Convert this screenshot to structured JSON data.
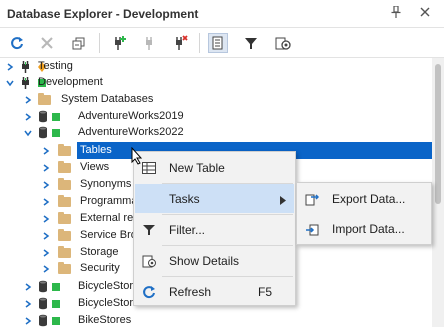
{
  "window": {
    "title": "Database Explorer - Development"
  },
  "titlebar_icons": [
    "pin-icon",
    "close-icon"
  ],
  "toolbar": {
    "buttons": [
      {
        "name": "refresh-button",
        "icon": "refresh-icon"
      },
      {
        "name": "delete-button",
        "icon": "delete-icon"
      },
      {
        "name": "collapse-all-button",
        "icon": "collapse-icon"
      },
      {
        "name": "new-connection-button",
        "icon": "plug-add-icon"
      },
      {
        "name": "disconnect-button",
        "icon": "plug-icon"
      },
      {
        "name": "delete-connection-button",
        "icon": "plug-delete-icon"
      },
      {
        "name": "show-details-button",
        "icon": "details-icon"
      },
      {
        "name": "filter-button",
        "icon": "filter-icon"
      },
      {
        "name": "connection-settings-button",
        "icon": "connection-settings-icon"
      }
    ]
  },
  "tree": [
    {
      "label": "Testing",
      "level": 0,
      "icon": "connection",
      "expander": "right"
    },
    {
      "label": "Development",
      "level": 0,
      "icon": "connection",
      "expander": "down"
    },
    {
      "label": "System Databases",
      "level": 1,
      "icon": "folder",
      "expander": "right"
    },
    {
      "label": "AdventureWorks2019",
      "level": 1,
      "icon": "database",
      "expander": "right"
    },
    {
      "label": "AdventureWorks2022",
      "level": 1,
      "icon": "database",
      "expander": "down"
    },
    {
      "label": "Tables",
      "level": 2,
      "icon": "folder",
      "expander": "right",
      "selected": true
    },
    {
      "label": "Views",
      "level": 2,
      "icon": "folder",
      "expander": "right"
    },
    {
      "label": "Synonyms",
      "level": 2,
      "icon": "folder",
      "expander": "right"
    },
    {
      "label": "Programma",
      "level": 2,
      "icon": "folder",
      "expander": "right"
    },
    {
      "label": "External re",
      "level": 2,
      "icon": "folder",
      "expander": "right"
    },
    {
      "label": "Service Bro",
      "level": 2,
      "icon": "folder",
      "expander": "right"
    },
    {
      "label": "Storage",
      "level": 2,
      "icon": "folder",
      "expander": "right"
    },
    {
      "label": "Security",
      "level": 2,
      "icon": "folder",
      "expander": "right"
    },
    {
      "label": "BicycleStore",
      "level": 1,
      "icon": "database",
      "expander": "right"
    },
    {
      "label": "BicycleStore",
      "level": 1,
      "icon": "database",
      "expander": "right"
    },
    {
      "label": "BikeStores",
      "level": 1,
      "icon": "database",
      "expander": "right"
    }
  ],
  "context_menu": {
    "items": [
      {
        "label": "New Table",
        "icon": "new-table-icon",
        "shortcut": ""
      },
      {
        "label": "Tasks",
        "icon": "",
        "shortcut": "",
        "submenu": true,
        "highlighted": true
      },
      {
        "label": "Filter...",
        "icon": "filter-icon",
        "shortcut": ""
      },
      {
        "label": "Show Details",
        "icon": "details-icon",
        "shortcut": ""
      },
      {
        "label": "Refresh",
        "icon": "refresh-icon",
        "shortcut": "F5"
      }
    ]
  },
  "submenu": {
    "items": [
      {
        "label": "Export Data...",
        "icon": "export-data-icon"
      },
      {
        "label": "Import Data...",
        "icon": "import-data-icon"
      }
    ]
  },
  "colors": {
    "accent": "#0a64c8",
    "hover": "#cde0f6",
    "connected": "#2db84b",
    "testing": "#f0a020"
  }
}
